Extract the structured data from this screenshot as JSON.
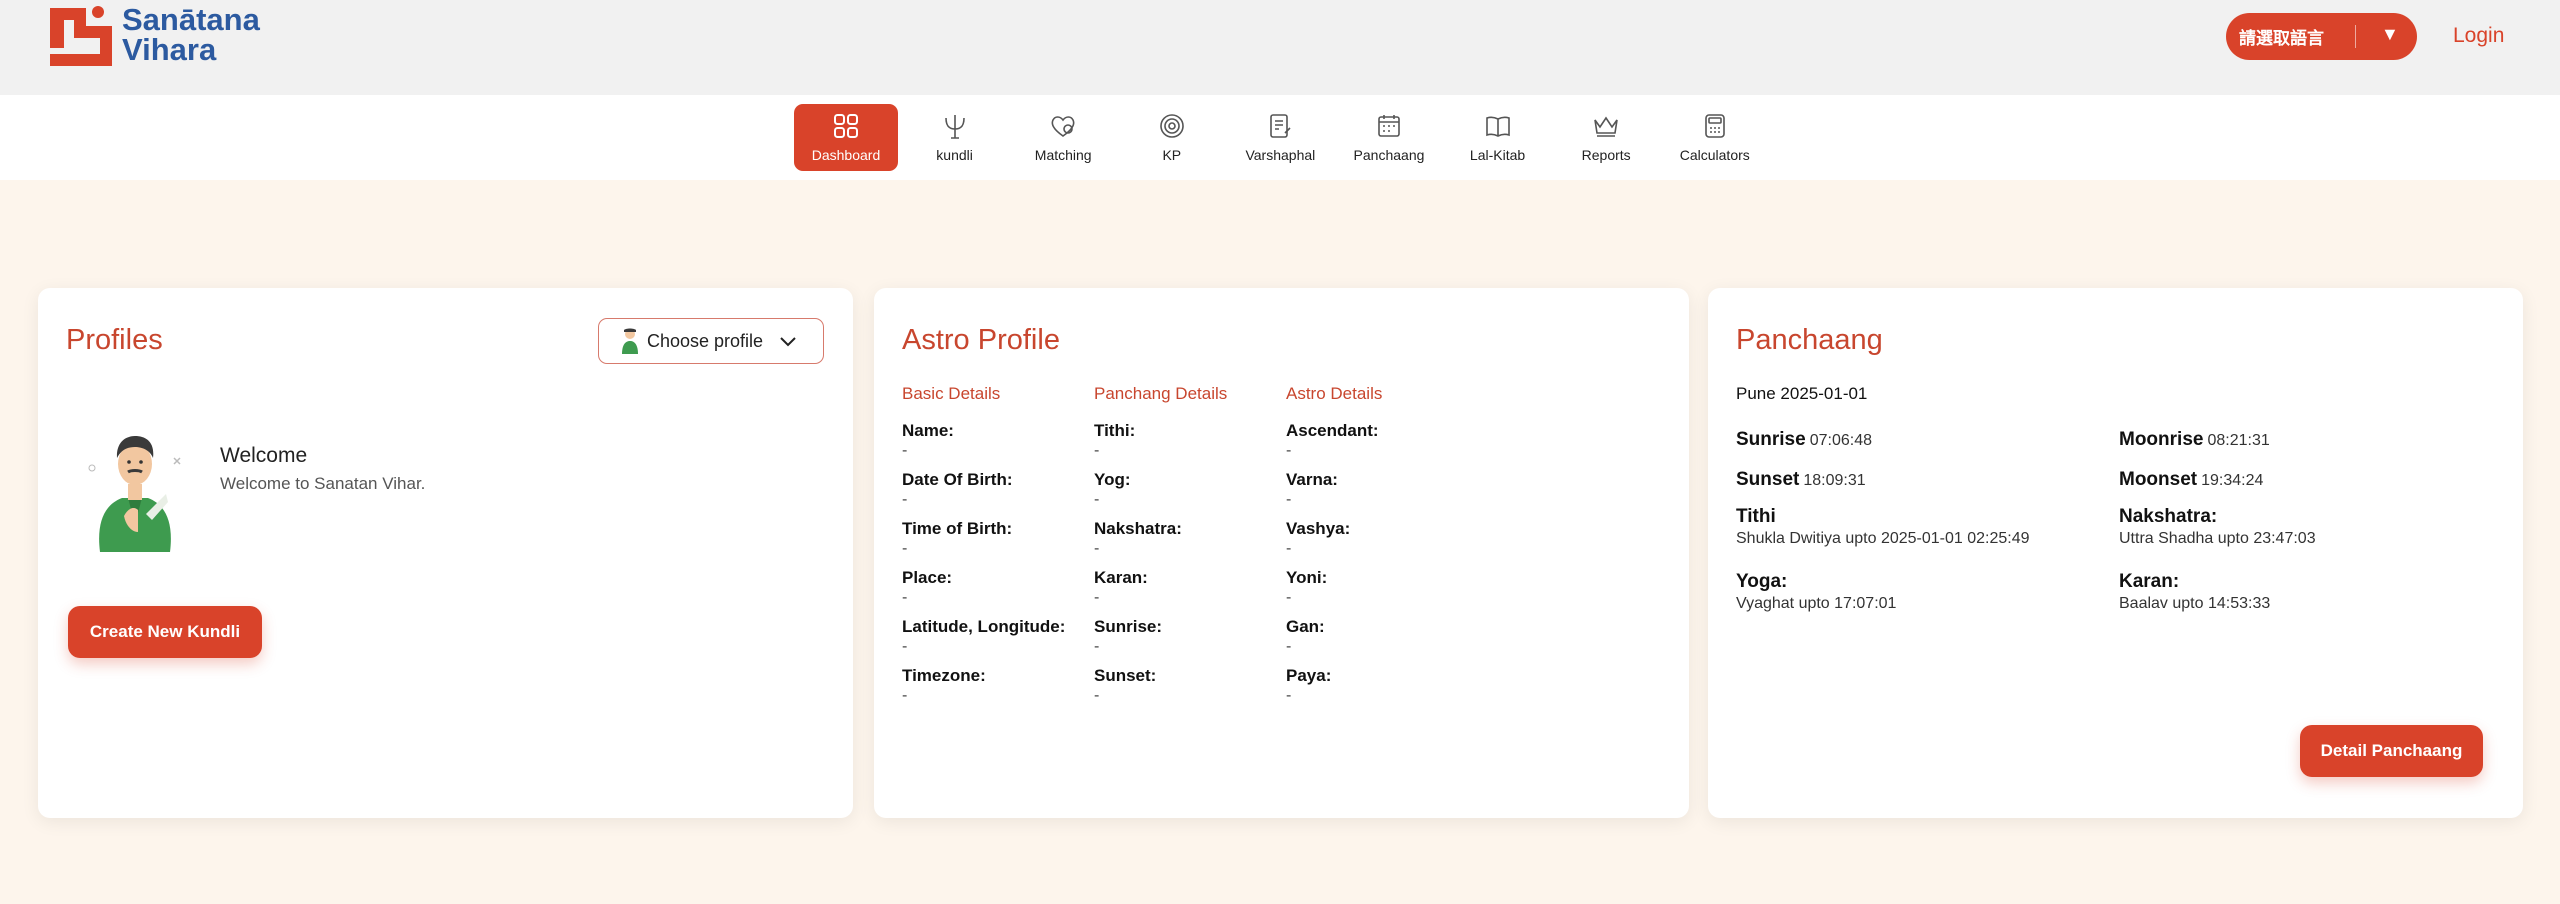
{
  "header": {
    "logo": {
      "line1": "Sanātana",
      "line2": "Vihara"
    },
    "language_button": {
      "label": "請選取語言",
      "caret": "▼"
    },
    "login_label": "Login"
  },
  "nav": {
    "items": [
      {
        "label": "Dashboard",
        "icon": "dashboard-grid-icon",
        "active": true
      },
      {
        "label": "kundli",
        "icon": "trident-icon"
      },
      {
        "label": "Matching",
        "icon": "hearts-icon"
      },
      {
        "label": "KP",
        "icon": "spiral-icon"
      },
      {
        "label": "Varshaphal",
        "icon": "document-pen-icon"
      },
      {
        "label": "Panchaang",
        "icon": "calendar-icon"
      },
      {
        "label": "Lal-Kitab",
        "icon": "book-icon"
      },
      {
        "label": "Reports",
        "icon": "crown-icon"
      },
      {
        "label": "Calculators",
        "icon": "calculator-icon"
      }
    ]
  },
  "profiles": {
    "title": "Profiles",
    "choose_profile": "Choose profile",
    "welcome_title": "Welcome",
    "welcome_text": "Welcome to Sanatan Vihar.",
    "create_button": "Create New Kundli"
  },
  "astro_profile": {
    "title": "Astro Profile",
    "columns": [
      {
        "heading": "Basic Details",
        "rows": [
          {
            "label": "Name:",
            "value": "-"
          },
          {
            "label": "Date Of Birth:",
            "value": "-"
          },
          {
            "label": "Time of Birth:",
            "value": "-"
          },
          {
            "label": "Place:",
            "value": "-"
          },
          {
            "label": "Latitude, Longitude:",
            "value": "-"
          },
          {
            "label": "Timezone:",
            "value": "-"
          }
        ]
      },
      {
        "heading": "Panchang Details",
        "rows": [
          {
            "label": "Tithi:",
            "value": "-"
          },
          {
            "label": "Yog:",
            "value": "-"
          },
          {
            "label": "Nakshatra:",
            "value": "-"
          },
          {
            "label": "Karan:",
            "value": "-"
          },
          {
            "label": "Sunrise:",
            "value": "-"
          },
          {
            "label": "Sunset:",
            "value": "-"
          }
        ]
      },
      {
        "heading": "Astro Details",
        "rows": [
          {
            "label": "Ascendant:",
            "value": "-"
          },
          {
            "label": "Varna:",
            "value": "-"
          },
          {
            "label": "Vashya:",
            "value": "-"
          },
          {
            "label": "Yoni:",
            "value": "-"
          },
          {
            "label": "Gan:",
            "value": "-"
          },
          {
            "label": "Paya:",
            "value": "-"
          }
        ]
      }
    ]
  },
  "panchaang": {
    "title": "Panchaang",
    "location_date": "Pune 2025-01-01",
    "sunrise": {
      "label": "Sunrise",
      "value": "07:06:48"
    },
    "sunset": {
      "label": "Sunset",
      "value": "18:09:31"
    },
    "moonrise": {
      "label": "Moonrise",
      "value": "08:21:31"
    },
    "moonset": {
      "label": "Moonset",
      "value": "19:34:24"
    },
    "tithi": {
      "label": "Tithi",
      "value": "Shukla Dwitiya upto 2025-01-01 02:25:49"
    },
    "nakshatra": {
      "label": "Nakshatra:",
      "value": "Uttra Shadha upto 23:47:03"
    },
    "yoga": {
      "label": "Yoga:",
      "value": "Vyaghat upto 17:07:01"
    },
    "karan": {
      "label": "Karan:",
      "value": "Baalav upto 14:53:33"
    },
    "detail_button": "Detail Panchaang"
  },
  "colors": {
    "accent": "#d9432a",
    "title": "#c8462e",
    "logo_blue": "#2c5aa0",
    "background": "#fdf5ec"
  }
}
